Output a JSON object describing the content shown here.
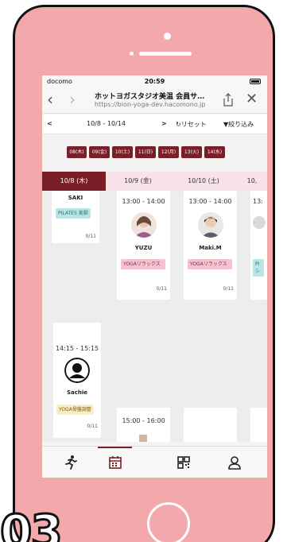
{
  "status": {
    "carrier": "docomo",
    "time": "20:59"
  },
  "browser": {
    "title": "ホットヨガスタジオ美温 会員サ…",
    "url": "https://bion-yoga-dev.hacomono.jp"
  },
  "toolbar": {
    "prev": "<",
    "range": "10/8 - 10/14",
    "next": ">",
    "reset": "リセット",
    "filter": "絞り込み"
  },
  "days": [
    "08(木)",
    "09(金)",
    "10(土)",
    "11(日)",
    "12(月)",
    "13(火)",
    "14(水)"
  ],
  "columns": [
    {
      "label": "10/8 (木)",
      "active": true
    },
    {
      "label": "10/9 (金)",
      "active": false
    },
    {
      "label": "10/10 (土)",
      "active": false
    },
    {
      "label": "10,",
      "active": false
    }
  ],
  "cards": {
    "c1": {
      "name": "SAKI",
      "tag": "PILATES 美脚",
      "count": "0/11"
    },
    "c2": {
      "time": "13:00 - 14:00",
      "name": "YUZU",
      "tag": "YOGAリラックス",
      "count": "0/11"
    },
    "c3": {
      "time": "13:00 - 14:00",
      "name": "Maki.M",
      "tag": "YOGAリラックス",
      "count": "0/11"
    },
    "c4": {
      "time": "13:",
      "tag": "PI シ"
    },
    "c5": {
      "time": "14:15 - 15:15",
      "name": "Sachie",
      "tag": "YOGA骨盤調整",
      "count": "0/11"
    },
    "c6": {
      "time": "15:00 - 16:00"
    }
  },
  "tabs": [
    "runner-icon",
    "calendar-icon",
    "qr-icon",
    "user-icon"
  ],
  "caption": "03",
  "colors": {
    "accent": "#7a1f27",
    "phone": "#f3a9ac"
  }
}
